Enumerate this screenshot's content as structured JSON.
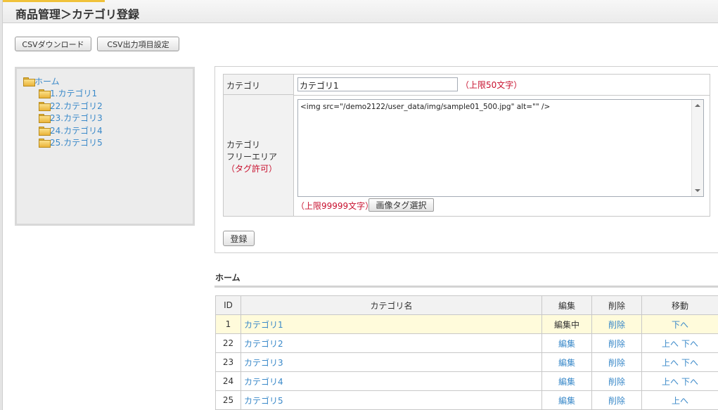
{
  "header": {
    "title": "商品管理＞カテゴリ登録"
  },
  "toolbar": {
    "csv_download": "CSVダウンロード",
    "csv_settings": "CSV出力項目設定"
  },
  "tree": {
    "root": "ホーム",
    "items": [
      "1.カテゴリ1",
      "22.カテゴリ2",
      "23.カテゴリ3",
      "24.カテゴリ4",
      "25.カテゴリ5"
    ]
  },
  "form": {
    "category_label": "カテゴリ",
    "category_value": "カテゴリ1",
    "category_limit": "（上限50文字）",
    "freearea_label_1": "カテゴリ",
    "freearea_label_2": "フリーエリア",
    "freearea_label_3": "（タグ許可）",
    "freearea_value": "<img src=\"/demo2122/user_data/img/sample01_500.jpg\" alt=\"\" />",
    "freearea_limit": "（上限99999文字）",
    "image_tag_button": "画像タグ選択",
    "submit_button": "登録"
  },
  "list": {
    "section_title": "ホーム",
    "columns": {
      "id": "ID",
      "name": "カテゴリ名",
      "edit": "編集",
      "delete": "削除",
      "move": "移動"
    },
    "rows": [
      {
        "id": "1",
        "name": "カテゴリ1",
        "edit": "編集中",
        "delete": "削除",
        "up": "",
        "down": "下へ"
      },
      {
        "id": "22",
        "name": "カテゴリ2",
        "edit": "編集",
        "delete": "削除",
        "up": "上へ",
        "down": "下へ"
      },
      {
        "id": "23",
        "name": "カテゴリ3",
        "edit": "編集",
        "delete": "削除",
        "up": "上へ",
        "down": "下へ"
      },
      {
        "id": "24",
        "name": "カテゴリ4",
        "edit": "編集",
        "delete": "削除",
        "up": "上へ",
        "down": "下へ"
      },
      {
        "id": "25",
        "name": "カテゴリ5",
        "edit": "編集",
        "delete": "削除",
        "up": "上へ",
        "down": ""
      }
    ]
  },
  "colors": {
    "link": "#3a89c9",
    "required": "#c8102e",
    "current_row": "#fffbdb"
  }
}
